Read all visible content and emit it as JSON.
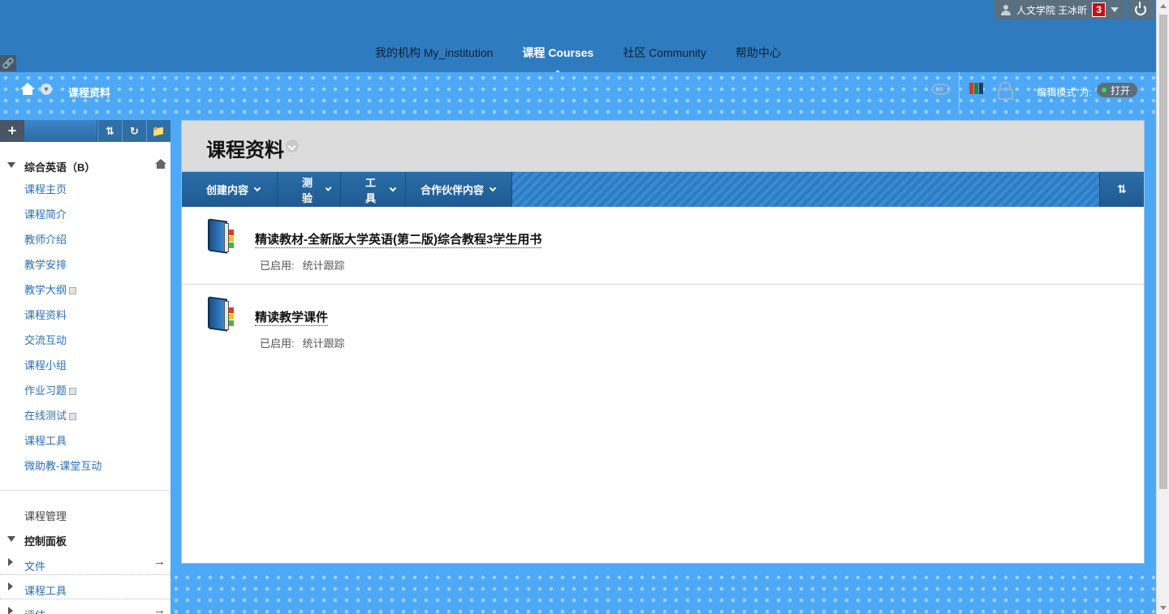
{
  "header": {
    "user_label": "人文学院 王冰昕",
    "notification_count": "3",
    "tabs": [
      {
        "label": "我的机构 My_institution",
        "active": false
      },
      {
        "label": "课程 Courses",
        "active": true
      },
      {
        "label": "社区 Community",
        "active": false
      },
      {
        "label": "帮助中心",
        "active": false
      }
    ]
  },
  "breadcrumb": {
    "title": "课程资料",
    "edit_mode_label": "\"编辑模式\"为:",
    "edit_mode_state": "打开"
  },
  "sidebar": {
    "course_name": "综合英语（B）",
    "items": [
      {
        "label": "课程主页",
        "has_badge": false
      },
      {
        "label": "课程简介",
        "has_badge": false
      },
      {
        "label": "教师介绍",
        "has_badge": false
      },
      {
        "label": "教学安排",
        "has_badge": false
      },
      {
        "label": "教学大纲",
        "has_badge": true
      },
      {
        "label": "课程资料",
        "has_badge": false
      },
      {
        "label": "交流互动",
        "has_badge": false
      },
      {
        "label": "课程小组",
        "has_badge": false
      },
      {
        "label": "作业习题",
        "has_badge": true
      },
      {
        "label": "在线测试",
        "has_badge": true
      },
      {
        "label": "课程工具",
        "has_badge": false
      },
      {
        "label": "微助教-课堂互动",
        "has_badge": false
      }
    ],
    "management_label": "课程管理",
    "control_panel_label": "控制面板",
    "control_panel_items": [
      {
        "label": "文件",
        "arrow": "→"
      },
      {
        "label": "课程工具",
        "arrow": ""
      },
      {
        "label": "评估",
        "arrow": "→"
      }
    ]
  },
  "content": {
    "title": "课程资料",
    "actions": [
      "创建内容",
      "测验",
      "工具",
      "合作伙伴内容"
    ],
    "items": [
      {
        "title": "精读教材-全新版大学英语(第二版)综合教程3学生用书",
        "meta_label": "已启用:",
        "meta_value": "统计跟踪"
      },
      {
        "title": "精读教学课件",
        "meta_label": "已启用:",
        "meta_value": "统计跟踪"
      }
    ]
  },
  "colors": {
    "header_bg": "#2f7bc0",
    "band_bg": "#4da9f5",
    "action_bar": "#2c7bc3",
    "link": "#2a6fb0"
  }
}
